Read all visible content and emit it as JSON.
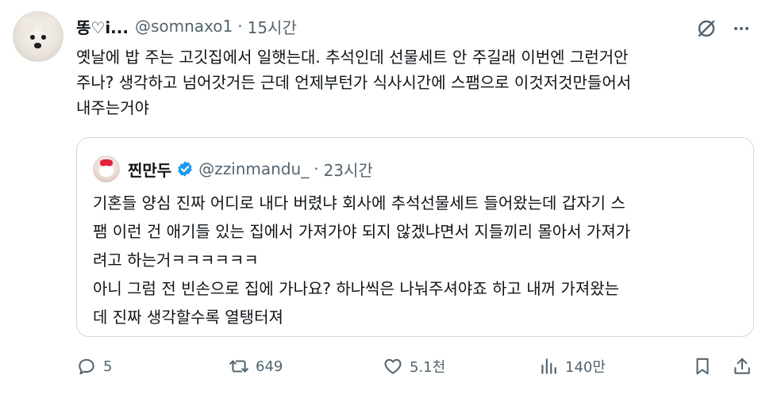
{
  "author": {
    "name": "똥♡i...",
    "handle": "@somnaxo1",
    "time": "15시간"
  },
  "tweet": {
    "lines": [
      "옛날에 밥 주는 고깃집에서 일햇는대.  추석인데  선물세트 안 주길래 이번엔 그런거안",
      "주나? 생각하고 넘어갓거든 근데 언제부턴가 식사시간에 스팸으로 이것저것만들어서",
      "내주는거야"
    ]
  },
  "quote": {
    "name": "찐만두",
    "handle": "@zzinmandu_",
    "time": "23시간",
    "lines": [
      "기혼들 양심 진짜 어디로 내다 버렸냐 회사에 추석선물세트 들어왔는데 갑자기 스",
      "팸 이런 건 애기들 있는 집에서 가져가야 되지 않겠냐면서 지들끼리 몰아서 가져가",
      "려고 하는거ㅋㅋㅋㅋㅋㅋ",
      "아니 그럼 전 빈손으로 집에 가나요? 하나씩은 나눠주셔야죠 하고 내꺼 가져왔는",
      "데 진짜 생각할수록 열탱터져"
    ]
  },
  "actions": {
    "replies": "5",
    "reposts": "649",
    "likes": "5.1천",
    "views": "140만"
  },
  "separator": "·",
  "colors": {
    "text": "#0f1419",
    "secondary": "#536471",
    "border": "#cfd9de",
    "verified": "#1d9bf0"
  }
}
